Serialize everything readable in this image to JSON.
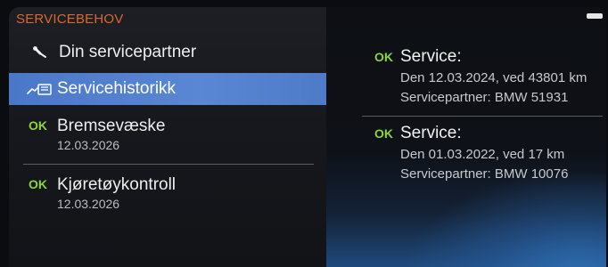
{
  "header": {
    "title": "SERVICEBEHOV"
  },
  "menu": {
    "partner": {
      "label": "Din servicepartner",
      "icon": "wrench-icon"
    },
    "history": {
      "label": "Servicehistorikk",
      "icon": "service-book-icon"
    },
    "brake": {
      "status": "OK",
      "label": "Bremsevæske",
      "date": "12.03.2026"
    },
    "inspection": {
      "status": "OK",
      "label": "Kjøretøykontroll",
      "date": "12.03.2026"
    }
  },
  "history_entries": [
    {
      "status": "OK",
      "title": "Service:",
      "line1": "Den 12.03.2024, ved 43801 km",
      "line2": "Servicepartner: BMW 51931"
    },
    {
      "status": "OK",
      "title": "Service:",
      "line1": "Den 01.03.2022, ved 17 km",
      "line2": "Servicepartner: BMW 10076"
    }
  ],
  "colors": {
    "ok": "#8bd43a",
    "header": "#d8682f",
    "selection": "#5a87d4"
  }
}
